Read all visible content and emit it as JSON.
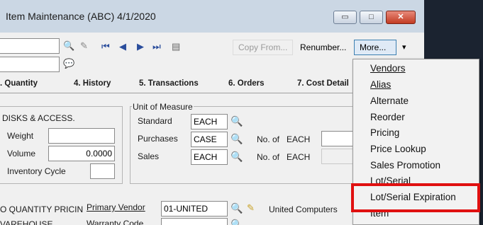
{
  "window": {
    "title": "Item Maintenance (ABC) 4/1/2020",
    "minimize_glyph": "▭",
    "maximize_glyph": "□",
    "close_glyph": "✕"
  },
  "toolbar": {
    "copy_from_label": "Copy From...",
    "renumber_label": "Renumber...",
    "more_label": "More...",
    "dropdown_glyph": "▾",
    "icons": {
      "search": "🔍",
      "clip": "✎",
      "first": "⏮",
      "prev": "◀",
      "next": "▶",
      "last": "⏭",
      "notes": "▤",
      "comment": "💬"
    }
  },
  "tabs": [
    {
      "label": ". Quantity"
    },
    {
      "label": "4. History"
    },
    {
      "label": "5. Transactions"
    },
    {
      "label": "6. Orders"
    },
    {
      "label": "7. Cost Detail"
    }
  ],
  "left_panel": {
    "category": "DISKS & ACCESS.",
    "weight_label": "Weight",
    "weight_value": "",
    "volume_label": "Volume",
    "volume_value": "0.0000",
    "inventory_cycle_label": "Inventory Cycle",
    "inventory_cycle_value": ""
  },
  "unit_of_measure": {
    "legend": "Unit of Measure",
    "standard_label": "Standard",
    "standard_value": "EACH",
    "purchases_label": "Purchases",
    "purchases_value": "CASE",
    "sales_label": "Sales",
    "sales_value": "EACH",
    "no_of_label_1": "No. of",
    "no_of_unit_1": "EACH",
    "no_of_label_2": "No. of",
    "no_of_unit_2": "EACH"
  },
  "bottom": {
    "quantity_pricing": "O QUANTITY PRICIN",
    "warehouse": "VAREHOUSE",
    "primary_vendor_label": "Primary Vendor",
    "primary_vendor_value": "01-UNITED",
    "vendor_name": "United Computers",
    "warranty_code_label": "Warranty Code"
  },
  "more_menu": {
    "items": [
      {
        "label": "Vendors"
      },
      {
        "label": "Alias"
      },
      {
        "label": "Alternate"
      },
      {
        "label": "Reorder"
      },
      {
        "label": "Pricing"
      },
      {
        "label": "Price Lookup"
      },
      {
        "label": "Sales Promotion"
      },
      {
        "label": "Lot/Serial"
      },
      {
        "label": "Lot/Serial Expiration"
      },
      {
        "label": "Item"
      }
    ],
    "highlighted_item": "Lot/Serial Expiration",
    "highlight_color": "#e01010"
  }
}
